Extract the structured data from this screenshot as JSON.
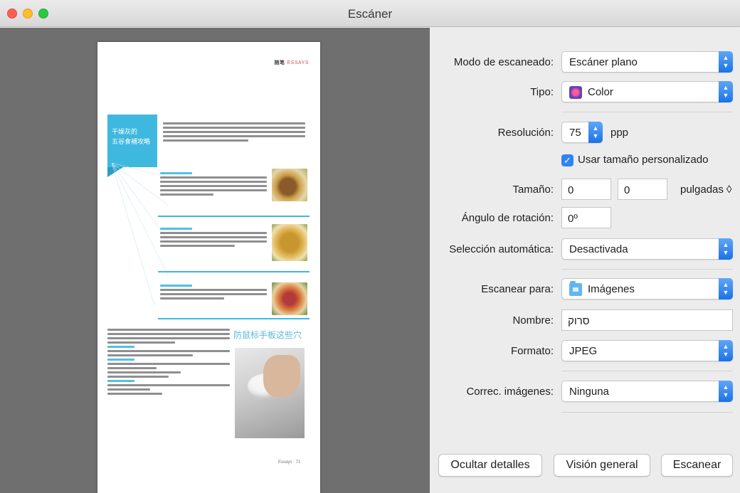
{
  "window": {
    "title": "Escáner"
  },
  "preview": {
    "header_tag_bold": "随笔",
    "header_tag": "ESSAYS",
    "banner_line1": "干燥灰的",
    "banner_line2": "五谷食補攻略",
    "section_title": "防鼠标手板这些穴",
    "page_number": "Essays · 71"
  },
  "settings": {
    "scan_mode_label": "Modo de escaneado:",
    "scan_mode_value": "Escáner plano",
    "type_label": "Tipo:",
    "type_value": "Color",
    "resolution_label": "Resolución:",
    "resolution_value": "75",
    "resolution_unit": "ppp",
    "custom_size_label": "Usar tamaño personalizado",
    "size_label": "Tamaño:",
    "size_width": "0",
    "size_height": "0",
    "size_unit": "pulgadas ◊",
    "rotation_label": "Ángulo de rotación:",
    "rotation_value": "0º",
    "auto_select_label": "Selección automática:",
    "auto_select_value": "Desactivada",
    "scan_to_label": "Escanear para:",
    "scan_to_value": "Imágenes",
    "name_label": "Nombre:",
    "name_value": "סרוק",
    "format_label": "Formato:",
    "format_value": "JPEG",
    "correction_label": "Correc. imágenes:",
    "correction_value": "Ninguna"
  },
  "buttons": {
    "hide_details": "Ocultar detalles",
    "overview": "Visión general",
    "scan": "Escanear"
  },
  "colors": {
    "accent": "#2f84f0",
    "preview_bg": "#6f6f70",
    "banner": "#3fb8df"
  }
}
